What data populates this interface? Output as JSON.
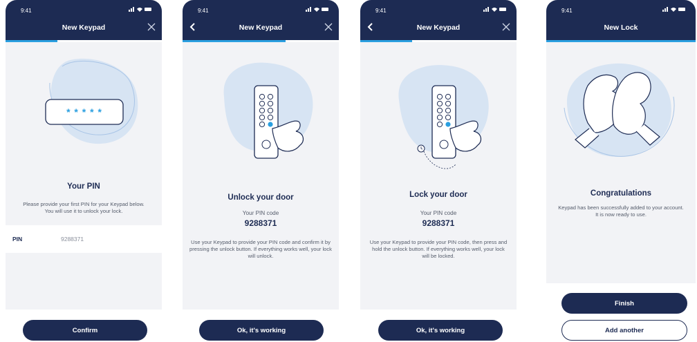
{
  "status": {
    "time": "9:41"
  },
  "colors": {
    "navy": "#1d2b53",
    "accent": "#2a9fe0",
    "background": "#f2f3f6"
  },
  "screens": [
    {
      "header_title": "New Keypad",
      "progress": 0.33,
      "masked_pin": "* * * * *",
      "title": "Your PIN",
      "body": "Please provide your first PIN for your Keypad below. You will use it to unlock your lock.",
      "pin_field": {
        "label": "PIN",
        "value": "9288371"
      },
      "button": "Confirm"
    },
    {
      "header_title": "New Keypad",
      "progress": 0.66,
      "title": "Unlock your door",
      "pin_label": "Your PIN code",
      "pin_code": "9288371",
      "body": "Use your Keypad to provide your PIN code and confirm it by pressing the unlock button. If everything works well, your lock will unlock.",
      "button": "Ok, it's working"
    },
    {
      "header_title": "New Keypad",
      "progress": 0.33,
      "title": "Lock your door",
      "pin_label": "Your PIN code",
      "pin_code": "9288371",
      "body": "Use your Keypad to provide your PIN code, then press and hold the unlock button. If everything works well, your lock will be locked.",
      "button": "Ok, it's working"
    },
    {
      "header_title": "New Lock",
      "progress": 1.0,
      "title": "Congratulations",
      "body": "Keypad has been successfully added to your account. It is now ready to use.",
      "primary_button": "Finish",
      "secondary_button": "Add another"
    }
  ]
}
